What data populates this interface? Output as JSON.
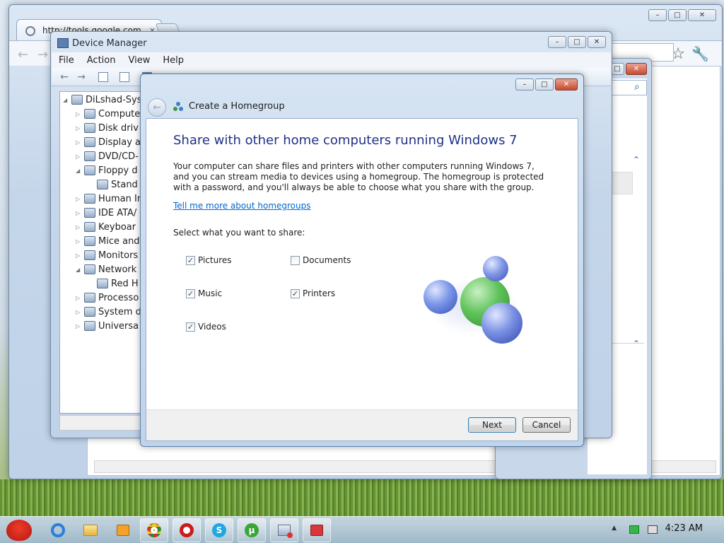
{
  "browser": {
    "tab_title": "http://tools.google.com",
    "tab_close": "×",
    "back_glyph": "←",
    "forward_glyph": "→",
    "star_glyph": "☆",
    "wrench_glyph": "🔧"
  },
  "bg_dialog": {
    "search_glyph": "⌕",
    "chevron_up": "⌃"
  },
  "device_manager": {
    "title": "Device Manager",
    "menu": [
      "File",
      "Action",
      "View",
      "Help"
    ],
    "tree": [
      {
        "label": "DiLshad-Sys",
        "expander": "◢",
        "indent": 0
      },
      {
        "label": "Compute",
        "expander": "▷",
        "indent": 1
      },
      {
        "label": "Disk driv",
        "expander": "▷",
        "indent": 1
      },
      {
        "label": "Display a",
        "expander": "▷",
        "indent": 1
      },
      {
        "label": "DVD/CD-",
        "expander": "▷",
        "indent": 1
      },
      {
        "label": "Floppy d",
        "expander": "◢",
        "indent": 1
      },
      {
        "label": "Stand",
        "expander": "",
        "indent": 2
      },
      {
        "label": "Human In",
        "expander": "▷",
        "indent": 1
      },
      {
        "label": "IDE ATA/",
        "expander": "▷",
        "indent": 1
      },
      {
        "label": "Keyboar",
        "expander": "▷",
        "indent": 1
      },
      {
        "label": "Mice and",
        "expander": "▷",
        "indent": 1
      },
      {
        "label": "Monitors",
        "expander": "▷",
        "indent": 1
      },
      {
        "label": "Network",
        "expander": "◢",
        "indent": 1
      },
      {
        "label": "Red H",
        "expander": "",
        "indent": 2
      },
      {
        "label": "Processo",
        "expander": "▷",
        "indent": 1
      },
      {
        "label": "System d",
        "expander": "▷",
        "indent": 1
      },
      {
        "label": "Universa",
        "expander": "▷",
        "indent": 1
      }
    ]
  },
  "wizard": {
    "title": "Create a Homegroup",
    "heading": "Share with other home computers running Windows 7",
    "description": "Your computer can share files and printers with other computers running Windows 7, and you can stream media to devices using a homegroup. The homegroup is protected with a password, and you'll always be able to choose what you share with the group.",
    "link": "Tell me more about homegroups",
    "select_label": "Select what you want to share:",
    "options": [
      {
        "label": "Pictures",
        "checked": true
      },
      {
        "label": "Documents",
        "checked": false
      },
      {
        "label": "Music",
        "checked": true
      },
      {
        "label": "Printers",
        "checked": true
      },
      {
        "label": "Videos",
        "checked": true
      }
    ],
    "next_label": "Next",
    "cancel_label": "Cancel",
    "check_mark": "✓"
  },
  "window_controls": {
    "minimize": "–",
    "maximize": "□",
    "close": "✕"
  },
  "taskbar": {
    "clock": "4:23 AM",
    "show_hidden": "▲",
    "apps": [
      "angry-birds-icon",
      "internet-explorer-icon",
      "explorer-folder-icon",
      "media-player-icon",
      "chrome-icon",
      "opera-icon",
      "skype-icon",
      "utorrent-icon",
      "device-manager-icon",
      "homegroup-icon"
    ]
  },
  "colors": {
    "heading_blue": "#1e3287",
    "link_blue": "#0066cc"
  }
}
